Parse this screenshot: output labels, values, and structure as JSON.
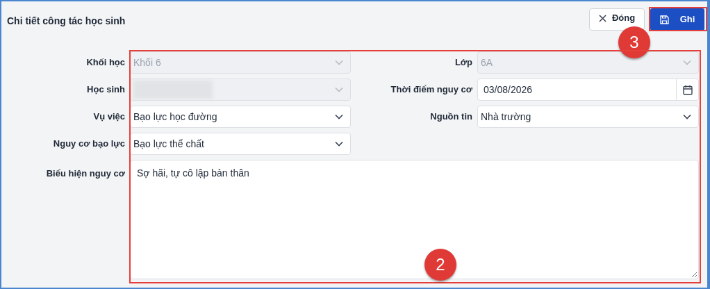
{
  "title": "Chi tiết công tác học sinh",
  "buttons": [
    {
      "kind": "close",
      "label": "Đóng"
    },
    {
      "kind": "save",
      "label": "Ghi"
    }
  ],
  "fields": [
    {
      "label": "Khối học",
      "kind": "select",
      "value": "Khối 6",
      "disabled": true
    },
    {
      "label": "Lớp",
      "kind": "select",
      "value": "6A",
      "disabled": true
    },
    {
      "label": "Học sinh",
      "kind": "select",
      "redacted": true,
      "disabled": true
    },
    {
      "label": "Thời điểm nguy cơ",
      "kind": "date",
      "value": "03/08/2026",
      "disabled": false
    },
    {
      "label": "Vụ việc",
      "kind": "select",
      "value": "Bạo lực học đường",
      "disabled": false
    },
    {
      "label": "Nguồn tin",
      "kind": "select",
      "value": "Nhà trường",
      "disabled": false
    },
    {
      "label": "Nguy cơ bạo lực",
      "kind": "select",
      "value": "Bạo lực thể chất",
      "disabled": false
    },
    {
      "label": "Biểu hiện nguy cơ",
      "kind": "textarea",
      "value": "Sợ hãi, tự cô lập bản thân",
      "disabled": false
    }
  ],
  "annotations": [
    {
      "label": "3",
      "kind": "save-button"
    },
    {
      "label": "2",
      "kind": "form"
    }
  ]
}
